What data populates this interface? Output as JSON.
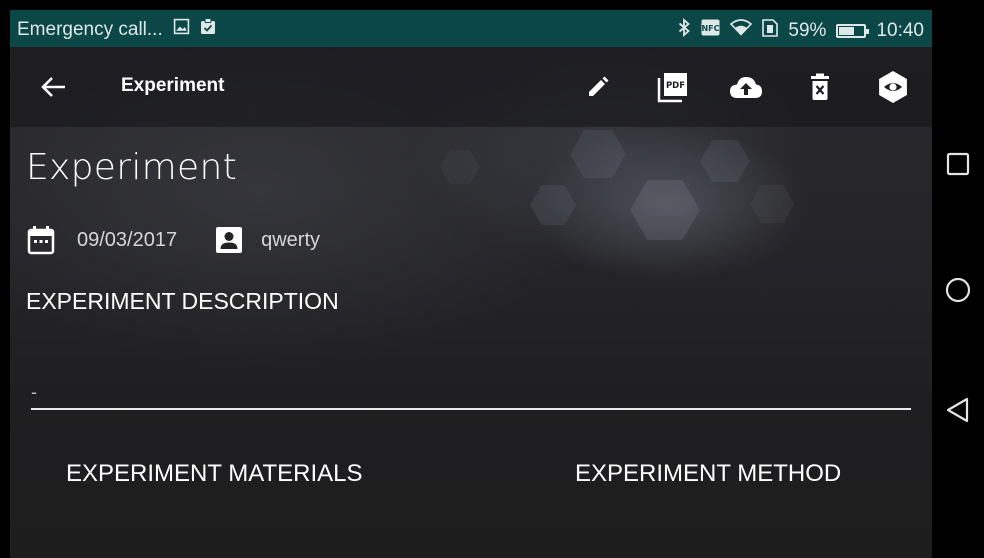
{
  "status_bar": {
    "notification_text": "Emergency call...",
    "battery_percent": "59%",
    "battery_level": 0.59,
    "time": "10:40",
    "icons": [
      "image-icon",
      "clipboard-icon",
      "bluetooth-icon",
      "nfc-icon",
      "wifi-icon",
      "sim-icon",
      "battery-icon"
    ]
  },
  "toolbar": {
    "title": "Experiment",
    "actions": [
      "back-arrow-icon",
      "edit-pencil-icon",
      "pdf-icon",
      "cloud-upload-icon",
      "delete-icon",
      "visibility-eye-icon"
    ]
  },
  "experiment": {
    "title": "Experiment",
    "date": "09/03/2017",
    "author": "qwerty",
    "description_heading": "EXPERIMENT DESCRIPTION",
    "description_value": "-",
    "tabs": {
      "materials": "EXPERIMENT MATERIALS",
      "method": "EXPERIMENT METHOD"
    }
  },
  "navigation": [
    "recents-square-icon",
    "home-circle-icon",
    "back-triangle-icon"
  ],
  "colors": {
    "status_bar": "#0c4747",
    "text": "#ffffff",
    "background": "#232325"
  }
}
